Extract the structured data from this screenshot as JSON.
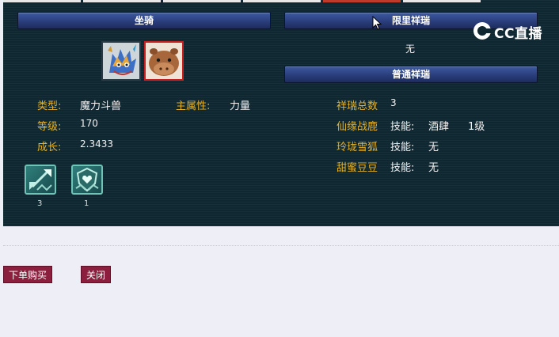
{
  "tabs": [
    "",
    "",
    "",
    "",
    "",
    ""
  ],
  "active_tab_index": 4,
  "mount": {
    "section_title": "坐骑",
    "type_label": "类型:",
    "type_value": "魔力斗兽",
    "attr_label": "主属性:",
    "attr_value": "力量",
    "level_label": "等级:",
    "level_value": "170",
    "growth_label": "成长:",
    "growth_value": "2.3433",
    "portraits": [
      {
        "icon": "dragon-mount-portrait-icon"
      },
      {
        "icon": "hippo-mount-portrait-icon"
      }
    ],
    "skills": [
      {
        "icon": "arrow-skill-icon",
        "count": "3"
      },
      {
        "icon": "shield-heart-skill-icon",
        "count": "1"
      }
    ]
  },
  "auspicious": {
    "limited_title": "限里祥瑞",
    "limited_value": "无",
    "normal_title": "普通祥瑞",
    "total_label": "祥瑞总数",
    "total_value": "3",
    "items": [
      {
        "name": "仙缘战鹿",
        "skill_label": "技能:",
        "skill_value": "酒肆",
        "level": "1级"
      },
      {
        "name": "玲珑雪狐",
        "skill_label": "技能:",
        "skill_value": "无",
        "level": ""
      },
      {
        "name": "甜蜜豆豆",
        "skill_label": "技能:",
        "skill_value": "无",
        "level": ""
      }
    ]
  },
  "watermark": {
    "text": "CC直播"
  },
  "buttons": {
    "buy": "下单购买",
    "close": "关闭"
  },
  "colors": {
    "label_gold": "#e7b224",
    "panel_bg": "#0f2731",
    "button_bg": "#8c1f3e",
    "bar_blue": "#2a3e7c"
  }
}
